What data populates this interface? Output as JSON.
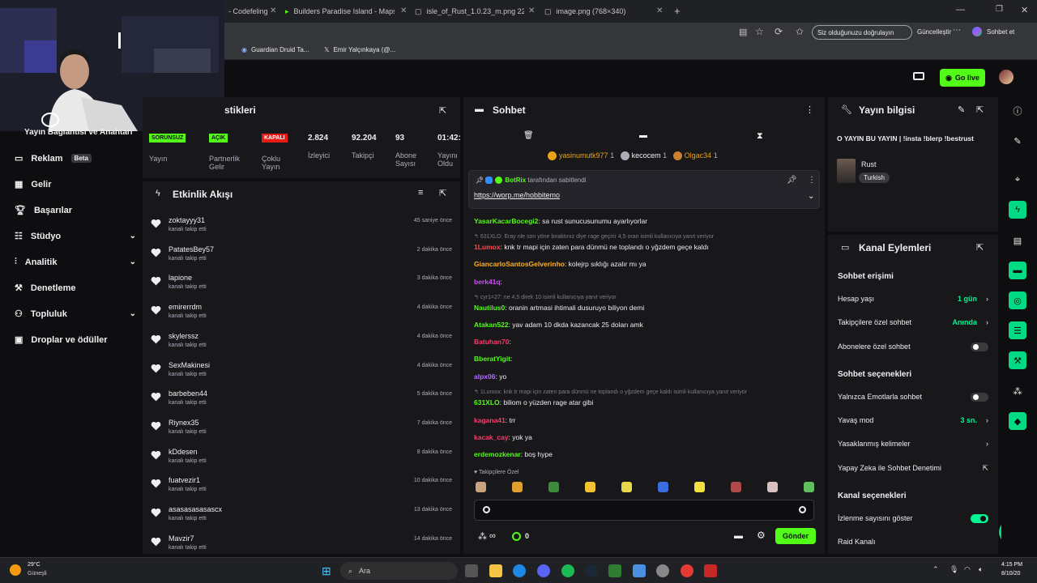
{
  "browser": {
    "tabs": [
      {
        "title": "- Codefeling"
      },
      {
        "title": "Builders Paradise Island - Maps - C"
      },
      {
        "title": "isle_of_Rust_1.0.23_m.png 22ce3"
      },
      {
        "title": "image.png (768×340)"
      }
    ],
    "verify_label": "Siz olduğunuzu doğrulayın",
    "update_label": "Güncelleştir",
    "chat_label": "Sohbet et",
    "bookmarks": [
      {
        "label": "Guardian Druid Ta..."
      },
      {
        "label": "Emir Yalçınkaya (@..."
      }
    ]
  },
  "header": {
    "go_live": "Go live"
  },
  "sidebar": {
    "connection_label": "Yayın Bağlantısı ve Anahtarı",
    "items": [
      {
        "label": "Reklam",
        "badge": "Beta"
      },
      {
        "label": "Gelir"
      },
      {
        "label": "Başarılar"
      },
      {
        "label": "Stüdyo"
      },
      {
        "label": "Analitik"
      },
      {
        "label": "Denetleme"
      },
      {
        "label": "Topluluk"
      },
      {
        "label": "Droplar ve ödüller"
      }
    ]
  },
  "stats": {
    "title": "stikleri",
    "cells": [
      {
        "badge": "SORUNSUZ",
        "label": "Yayın"
      },
      {
        "badge": "AÇIK",
        "label": "Partnerlik Gelir"
      },
      {
        "badge": "KAPALI",
        "label": "Çoklu Yayın"
      },
      {
        "value": "2.824",
        "label": "İzleyici"
      },
      {
        "value": "92.204",
        "label": "Takipçi"
      },
      {
        "value": "93",
        "label": "Abone Sayısı"
      },
      {
        "value": "01:42:",
        "label": "Yayını Oldu"
      }
    ]
  },
  "activity": {
    "title": "Etkinlik Akışı",
    "items": [
      {
        "name": "zoktayyy31",
        "action": "kanalı takip etti",
        "time": "45 saniye önce"
      },
      {
        "name": "PatatesBey57",
        "action": "kanalı takip etti",
        "time": "2 dakika önce"
      },
      {
        "name": "lapione",
        "action": "kanalı takip etti",
        "time": "3 dakika önce"
      },
      {
        "name": "emirerrdm",
        "action": "kanalı takip etti",
        "time": "4 dakika önce"
      },
      {
        "name": "skylerssz",
        "action": "kanalı takip etti",
        "time": "4 dakika önce"
      },
      {
        "name": "SexMakinesi",
        "action": "kanalı takip etti",
        "time": "4 dakika önce"
      },
      {
        "name": "barbeben44",
        "action": "kanalı takip etti",
        "time": "5 dakika önce"
      },
      {
        "name": "Riynex35",
        "action": "kanalı takip etti",
        "time": "7 dakika önce"
      },
      {
        "name": "kDdesen",
        "action": "kanalı takip etti",
        "time": "8 dakika önce"
      },
      {
        "name": "fuatvezir1",
        "action": "kanalı takip etti",
        "time": "10 dakika önce"
      },
      {
        "name": "asasasasasascx",
        "action": "kanalı takip etti",
        "time": "13 dakika önce"
      },
      {
        "name": "Mavzir7",
        "action": "kanalı takip etti",
        "time": "14 dakika önce"
      }
    ]
  },
  "chat": {
    "title": "Sohbet",
    "top_users": [
      {
        "name": "yasinumutk977",
        "count": "1"
      },
      {
        "name": "kecocem",
        "count": "1"
      },
      {
        "name": "Olgac34",
        "count": "1"
      }
    ],
    "pinned": {
      "by": "BotRix",
      "by_suffix": "tarafından sabitlendi",
      "link": "https://worp.me/hobbitemo"
    },
    "messages": [
      {
        "user": "YasarKacarBocegi2",
        "color": "#53fc18",
        "text": ": sa rust sunucusunumu ayarlıyorlar"
      },
      {
        "reply": "631XLO: Eray nle son yöne bıraktınız diye rage geçirir 4,5 oran isimli kullanıcıya yanıt veriyor"
      },
      {
        "user": "1Lumox",
        "color": "#ff4a4a",
        "text": ": knk tr mapi için zaten para dünmü ne toplandı o yğzdem geçe kaldı"
      },
      {
        "user": "GiancarloSantosGelverinho",
        "color": "#ffb020",
        "text": ": kolejrp sıklığı azalır mı ya"
      },
      {
        "user": "berk41q",
        "color": "#d14cff",
        "text": ":"
      },
      {
        "reply": "cyr1=27: ne 4,5 direk 10 isimli kullanıcıya yanıt veriyor"
      },
      {
        "user": "Nautilus0",
        "color": "#53fc18",
        "text": ": oranin artmasi ihtimali dusuruyo biliyon demi"
      },
      {
        "user": "Atakan522",
        "color": "#53fc18",
        "text": ": yav adam 10 dkda kazancak 25 doları amk"
      },
      {
        "user": "Batuhan70",
        "color": "#ff3b6b",
        "text": ":"
      },
      {
        "user": "BberatYigit",
        "color": "#53fc18",
        "text": ":"
      },
      {
        "user": "alpx06",
        "color": "#b06bff",
        "text": ": yo"
      },
      {
        "reply": "1Lumox: knk tr mapi için zaten para dünmü ne toplandı o yğzdem geçe kaldı isimli kullanıcıya yanıt veriyor"
      },
      {
        "user": "631XLO",
        "color": "#53fc18",
        "text": ": biliom o yüzden rage atar gibi"
      },
      {
        "user": "kagana41",
        "color": "#ff3b6b",
        "text": ": trr"
      },
      {
        "user": "kacak_cay",
        "color": "#ff3b6b",
        "text": ": yok ya"
      },
      {
        "user": "erdemozkenar",
        "color": "#53fc18",
        "text": ": boş hype"
      }
    ],
    "followers_only": "Takipçilere Özel",
    "points": "0",
    "send": "Gönder"
  },
  "stream_info": {
    "title": "Yayın bilgisi",
    "stream_title": "O YAYIN BU YAYIN | !insta !blerp !bestrust",
    "category": "Rust",
    "language": "Turkish"
  },
  "channel_actions": {
    "title": "Kanal Eylemleri",
    "chat_access": "Sohbet erişimi",
    "rows1": [
      {
        "label": "Hesap yaşı",
        "value": "1 gün"
      },
      {
        "label": "Takipçilere özel sohbet",
        "value": "Anında"
      },
      {
        "label": "Abonelere özel sohbet",
        "toggle": false
      }
    ],
    "chat_options": "Sohbet seçenekleri",
    "rows2": [
      {
        "label": "Yalnızca Emotlarla sohbet",
        "toggle": false
      },
      {
        "label": "Yavaş mod",
        "value": "3 sn."
      },
      {
        "label": "Yasaklanmış kelimeler"
      },
      {
        "label": "Yapay Zeka ile Sohbet Denetimi"
      }
    ],
    "channel_options": "Kanal seçenekleri",
    "rows3": [
      {
        "label": "İzlenme sayısını göster",
        "toggle": true
      },
      {
        "label": "Raid Kanalı"
      }
    ]
  },
  "taskbar": {
    "weather_temp": "29°C",
    "weather_label": "Güneşli",
    "search": "Ara",
    "time": "4:15 PM",
    "date": "8/10/20"
  },
  "colors": {
    "accent": "#53fc18",
    "panel": "#18181b",
    "bg": "#0e0e10"
  }
}
